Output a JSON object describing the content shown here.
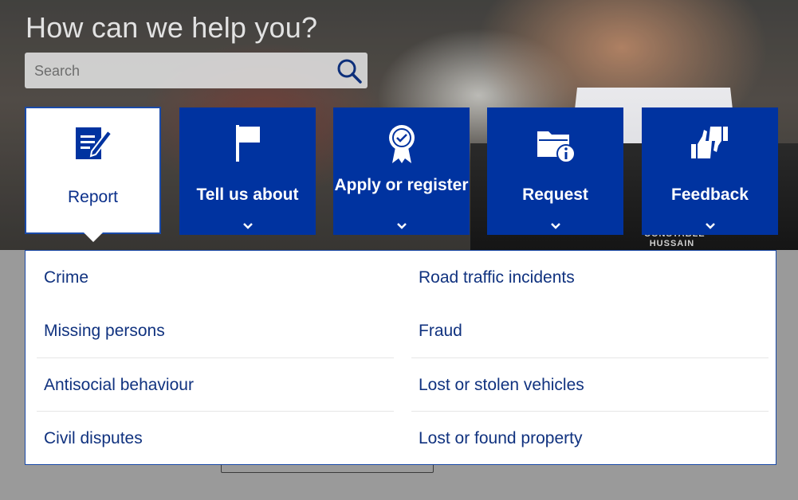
{
  "hero": {
    "title": "How can we help you?",
    "search": {
      "placeholder": "Search"
    },
    "badge_text": "CONSTABLE\nHUSSAIN"
  },
  "tiles": [
    {
      "label": "Report",
      "icon": "report-icon",
      "active": true
    },
    {
      "label": "Tell us about",
      "icon": "flag-icon",
      "active": false
    },
    {
      "label": "Apply or register",
      "icon": "award-ribbon-icon",
      "active": false
    },
    {
      "label": "Request",
      "icon": "folder-info-icon",
      "active": false
    },
    {
      "label": "Feedback",
      "icon": "thumbs-up-down-icon",
      "active": false
    }
  ],
  "report_menu": {
    "left": [
      "Crime",
      "Missing persons",
      "Antisocial behaviour",
      "Civil disputes"
    ],
    "right": [
      "Road traffic incidents",
      "Fraud",
      "Lost or stolen vehicles",
      "Lost or found property"
    ]
  },
  "colors": {
    "brand_blue": "#0033a0",
    "link_blue": "#10327f",
    "panel_bg": "#ffffff"
  }
}
